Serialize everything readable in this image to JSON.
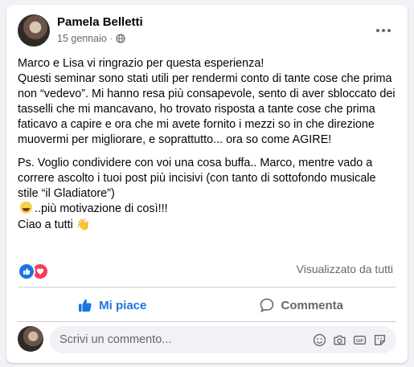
{
  "post": {
    "author": "Pamela Belletti",
    "date": "15 gennaio",
    "separator": "·",
    "audience_icon": "globe-icon",
    "paragraph1": [
      "Marco e Lisa vi ringrazio per questa esperienza!",
      "Questi seminar sono stati utili per rendermi conto di tante cose che prima non “vedevo”.  Mi hanno resa più consapevole, sento di aver sbloccato dei tasselli che mi mancavano, ho trovato risposta a tante cose che prima faticavo a capire e ora che mi avete fornito i mezzi so in che direzione muovermi per migliorare, e soprattutto... ora so come AGIRE!"
    ],
    "paragraph2": "Ps. Voglio condividere con voi una cosa buffa.. Marco, mentre vado a correre ascolto i tuoi post più incisivi (con tanto di sottofondo musicale stile “il Gladiatore”)",
    "paragraph2_tail": "..più motivazione di così!!!",
    "closing": "Ciao a tutti",
    "closing_emoji": "👋"
  },
  "reactions": {
    "icons": [
      "like-reaction-icon",
      "love-reaction-icon"
    ],
    "seen_by": "Visualizzato da tutti"
  },
  "actions": {
    "like": "Mi piace",
    "comment": "Commenta"
  },
  "comment_box": {
    "placeholder": "Scrivi un commento...",
    "icons": [
      "emoji-icon",
      "camera-icon",
      "gif-icon",
      "sticker-icon"
    ]
  },
  "colors": {
    "accent": "#1b74e4",
    "love": "#f33e58",
    "secondary_text": "#65676b",
    "background": "#f0f2f5"
  }
}
